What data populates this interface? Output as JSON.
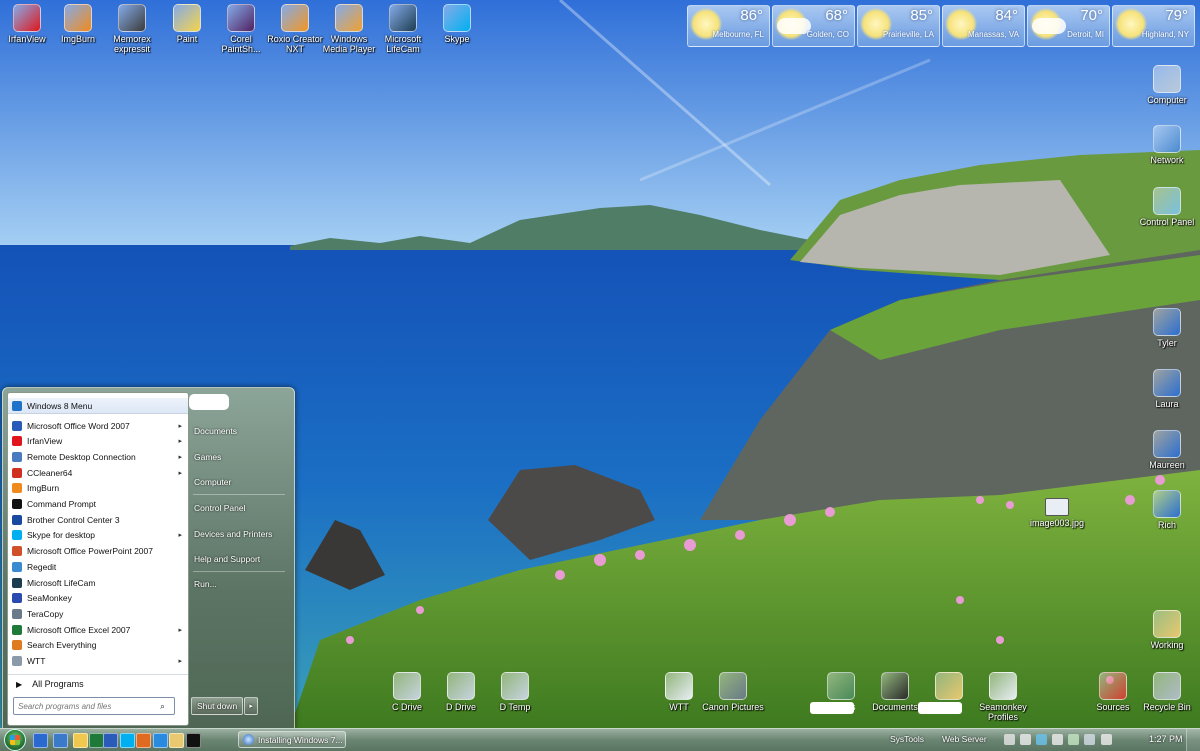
{
  "top_icons": [
    {
      "name": "irfanview-icon",
      "label": "IrfanView",
      "color": "#e0161c"
    },
    {
      "name": "imgburn-icon",
      "label": "ImgBurn",
      "color": "#f08a1c"
    },
    {
      "name": "memorex-icon",
      "label": "Memorex expressit",
      "color": "#3a3a3a"
    },
    {
      "name": "paint-icon",
      "label": "Paint",
      "color": "#f4d34a"
    },
    {
      "name": "paintshop-icon",
      "label": "Corel PaintSh...",
      "color": "#502060"
    },
    {
      "name": "roxio-icon",
      "label": "Roxio Creator NXT",
      "color": "#f29521"
    },
    {
      "name": "media-player-icon",
      "label": "Windows Media Player",
      "color": "#f0a030"
    },
    {
      "name": "lifecam-icon",
      "label": "Microsoft LifeCam",
      "color": "#1c3c50"
    },
    {
      "name": "skype-icon",
      "label": "Skype",
      "color": "#00aff0"
    }
  ],
  "right_icons": [
    {
      "name": "computer-icon",
      "label": "Computer",
      "color": "#b8c8d8"
    },
    {
      "name": "network-icon",
      "label": "Network",
      "color": "#4a8ad0"
    },
    {
      "name": "control-panel-icon",
      "label": "Control Panel",
      "color": "#7ac0e0"
    },
    {
      "name": "user-tyler-icon",
      "label": "Tyler",
      "color": "#2d6fd0"
    },
    {
      "name": "user-laura-icon",
      "label": "Laura",
      "color": "#2d6fd0"
    },
    {
      "name": "user-maureen-icon",
      "label": "Maureen",
      "color": "#2d6fd0"
    },
    {
      "name": "user-rich-icon",
      "label": "Rich",
      "color": "#2d6fd0"
    }
  ],
  "file_icon": {
    "label": "image003.jpg"
  },
  "bottom_icons": [
    {
      "name": "c-drive-icon",
      "label": "C Drive",
      "color": "#c8d4e0"
    },
    {
      "name": "d-drive-icon",
      "label": "D Drive",
      "color": "#c8d4e0"
    },
    {
      "name": "d-temp-icon",
      "label": "D Temp",
      "color": "#c8d4e0"
    },
    {
      "name": "wtt-icon",
      "label": "WTT",
      "color": "#e8eef4"
    },
    {
      "name": "canon-pictures-icon",
      "label": "Canon Pictures",
      "color": "#6a7a88"
    },
    {
      "name": "documents-blurred-icon",
      "label": "Documents",
      "color": "#4a8a5a"
    },
    {
      "name": "documents-icon",
      "label": "Documents",
      "color": "#2a2a2a"
    },
    {
      "name": "folder-blurred-icon",
      "label": "",
      "color": "#e8c870"
    },
    {
      "name": "seamonkey-profiles-icon",
      "label": "Seamonkey Profiles",
      "color": "#e8eef4"
    },
    {
      "name": "sources-icon",
      "label": "Sources",
      "color": "#d04030"
    },
    {
      "name": "recycle-bin-icon",
      "label": "Recycle Bin",
      "color": "#b0bcc8"
    },
    {
      "name": "working-folder-icon",
      "label": "Working",
      "color": "#e8c870"
    }
  ],
  "weather": [
    {
      "temp": "86°",
      "city": "Melbourne, FL"
    },
    {
      "temp": "68°",
      "city": "Golden, CO"
    },
    {
      "temp": "85°",
      "city": "Prairieville, LA"
    },
    {
      "temp": "84°",
      "city": "Manassas, VA"
    },
    {
      "temp": "70°",
      "city": "Detroit, MI"
    },
    {
      "temp": "79°",
      "city": "Highland, NY"
    }
  ],
  "start_menu": {
    "pinned": {
      "label": "Windows 8 Menu",
      "color": "#1e72c8"
    },
    "programs": [
      {
        "label": "Microsoft Office Word 2007",
        "arrow": "▸",
        "color": "#2b5bb8"
      },
      {
        "label": "IrfanView",
        "arrow": "▸",
        "color": "#e0161c"
      },
      {
        "label": "Remote Desktop Connection",
        "arrow": "▸",
        "color": "#4a7ac0"
      },
      {
        "label": "CCleaner64",
        "arrow": "▸",
        "color": "#d03020"
      },
      {
        "label": "ImgBurn",
        "arrow": "",
        "color": "#f08a1c"
      },
      {
        "label": "Command Prompt",
        "arrow": "",
        "color": "#111111"
      },
      {
        "label": "Brother Control Center 3",
        "arrow": "",
        "color": "#1a4aa0"
      },
      {
        "label": "Skype for desktop",
        "arrow": "▸",
        "color": "#00aff0"
      },
      {
        "label": "Microsoft Office PowerPoint 2007",
        "arrow": "",
        "color": "#d0502a"
      },
      {
        "label": "Regedit",
        "arrow": "",
        "color": "#3a8ad0"
      },
      {
        "label": "Microsoft LifeCam",
        "arrow": "",
        "color": "#1c3c50"
      },
      {
        "label": "SeaMonkey",
        "arrow": "",
        "color": "#2a4ab0"
      },
      {
        "label": "TeraCopy",
        "arrow": "",
        "color": "#6a7a8a"
      },
      {
        "label": "Microsoft Office Excel 2007",
        "arrow": "▸",
        "color": "#1f7a3a"
      },
      {
        "label": "Search Everything",
        "arrow": "",
        "color": "#e07a20"
      },
      {
        "label": "WTT",
        "arrow": "▸",
        "color": "#8a9aa8"
      }
    ],
    "all_programs": "All Programs",
    "search_placeholder": "Search programs and files",
    "right_links": [
      "Documents",
      "Games",
      "Computer",
      "Control Panel",
      "Devices and Printers",
      "Help and Support",
      "Run..."
    ],
    "shutdown_label": "Shut down",
    "shutdown_arrow": "▸"
  },
  "taskbar": {
    "quick_launch": [
      {
        "name": "ql-show-desktop-icon",
        "color": "#2a6ad0"
      },
      {
        "name": "ql-remote-desktop-icon",
        "color": "#3a7ac8"
      },
      {
        "name": "ql-explorer-icon",
        "color": "#f0c850"
      },
      {
        "name": "ql-excel-icon",
        "color": "#1f7a3a"
      },
      {
        "name": "ql-word-icon",
        "color": "#2b5bb8"
      },
      {
        "name": "ql-skype-icon",
        "color": "#00aff0"
      },
      {
        "name": "ql-seamonkey-icon",
        "color": "#e06a20"
      },
      {
        "name": "ql-ie-icon",
        "color": "#2a8ae0"
      },
      {
        "name": "ql-folder-icon",
        "color": "#e8c870"
      },
      {
        "name": "ql-cmd-icon",
        "color": "#111111"
      }
    ],
    "task_label": "Installing Windows 7...",
    "systools": "SysTools",
    "webserver": "Web Server",
    "clock": "1:27 PM",
    "tray": [
      {
        "name": "tray-arrows-icon",
        "color": "#e0e0e0"
      },
      {
        "name": "tray-network-icon",
        "color": "#e8e8e8"
      },
      {
        "name": "tray-sync-icon",
        "color": "#6ac0e8"
      },
      {
        "name": "tray-flag-icon",
        "color": "#e8e8e8"
      },
      {
        "name": "tray-battery-icon",
        "color": "#c0e0c0"
      },
      {
        "name": "tray-display-icon",
        "color": "#d0d8e0"
      },
      {
        "name": "tray-volume-icon",
        "color": "#e8e8e8"
      }
    ]
  }
}
